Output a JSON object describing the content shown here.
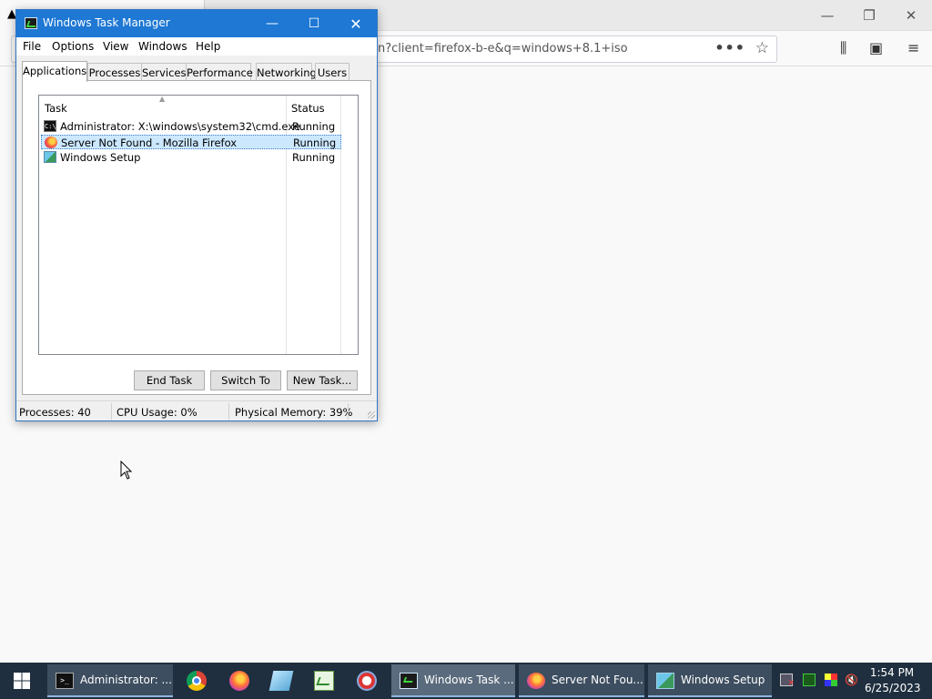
{
  "firefox": {
    "url": "n?client=firefox-b-e&q=windows+8.1+iso",
    "more_label": "•••"
  },
  "taskmanager": {
    "title": "Windows Task Manager",
    "menu": [
      "File",
      "Options",
      "View",
      "Windows",
      "Help"
    ],
    "tabs": [
      "Applications",
      "Processes",
      "Services",
      "Performance",
      "Networking",
      "Users"
    ],
    "active_tab": "Applications",
    "columns": {
      "task": "Task",
      "status": "Status"
    },
    "rows": [
      {
        "icon": "cmd-icon",
        "task": "Administrator: X:\\windows\\system32\\cmd.exe",
        "status": "Running"
      },
      {
        "icon": "firefox-icon",
        "task": "Server Not Found - Mozilla Firefox",
        "status": "Running",
        "selected": true
      },
      {
        "icon": "setup-icon",
        "task": "Windows Setup",
        "status": "Running"
      }
    ],
    "buttons": {
      "end_task": "End Task",
      "switch_to": "Switch To",
      "new_task": "New Task..."
    },
    "status": {
      "processes": "Processes: 40",
      "cpu": "CPU Usage: 0%",
      "memory": "Physical Memory: 39%"
    }
  },
  "taskbar": {
    "windows": [
      {
        "label": "Administrator: ...",
        "icon": "cmd-icon"
      },
      {
        "label": "Windows Task ...",
        "icon": "taskmanager-icon",
        "active": true
      },
      {
        "label": "Server Not Fou...",
        "icon": "firefox-icon"
      },
      {
        "label": "Windows Setup",
        "icon": "setup-icon"
      }
    ],
    "pinned": [
      "chrome-icon",
      "firefox-icon",
      "notepad-icon",
      "taskmanager-icon",
      "paint-icon"
    ],
    "clock": {
      "time": "1:54 PM",
      "date": "6/25/2023"
    }
  },
  "colors": {
    "titlebar": "#1e78d4",
    "selection": "#cce8ff",
    "taskbar": "#1f2f3f"
  }
}
